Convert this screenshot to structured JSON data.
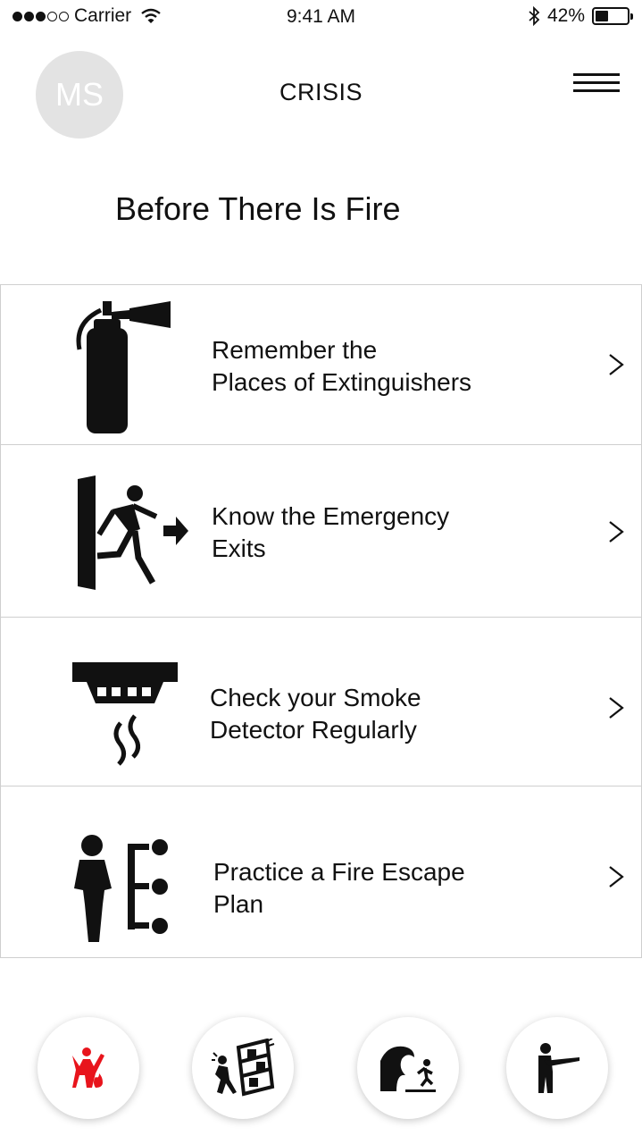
{
  "status_bar": {
    "carrier": "Carrier",
    "time": "9:41 AM",
    "battery_percent": "42%",
    "battery_level": 0.42,
    "icons": [
      "signal-dots-icon",
      "wifi-icon",
      "bluetooth-icon",
      "battery-icon"
    ]
  },
  "header": {
    "avatar_initials": "MS",
    "title": "CRISIS",
    "menu_icon": "hamburger-menu-icon"
  },
  "section": {
    "title": "Before There Is Fire"
  },
  "items": [
    {
      "label": "Remember the\nPlaces of Extinguishers",
      "icon": "fire-extinguisher-icon"
    },
    {
      "label": "Know the Emergency\nExits",
      "icon": "emergency-exit-icon"
    },
    {
      "label": "Check your Smoke\nDetector Regularly",
      "icon": "smoke-detector-icon"
    },
    {
      "label": "Practice a Fire Escape\nPlan",
      "icon": "escape-plan-icon"
    }
  ],
  "bottom_nav": [
    {
      "icon": "fire-crisis-icon",
      "active": true,
      "color": "#e8141c"
    },
    {
      "icon": "earthquake-icon",
      "active": false
    },
    {
      "icon": "tsunami-icon",
      "active": false
    },
    {
      "icon": "shooter-icon",
      "active": false
    }
  ]
}
